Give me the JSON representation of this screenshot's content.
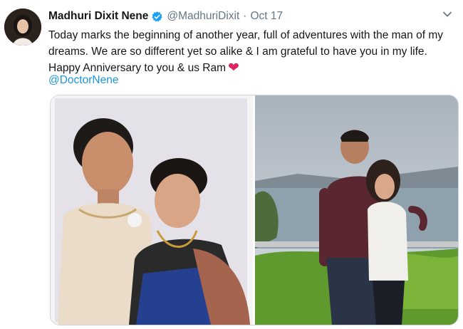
{
  "tweet": {
    "author_name": "Madhuri Dixit Nene",
    "handle": "@MadhuriDixit",
    "separator": "·",
    "date": "Oct 17",
    "text": "Today marks the beginning of another year, full of adventures with the man of my dreams. We are so different yet so alike & I am grateful to have you in my life. Happy Anniversary to you & us Ram",
    "mention": "@DoctorNene",
    "heart_glyph": "❤"
  },
  "icons": {
    "verified": "verified-badge-icon",
    "more": "chevron-down-icon",
    "heart": "heart-icon"
  },
  "colors": {
    "link": "#1b95e0",
    "verified": "#1da1f2",
    "muted": "#657786",
    "heart": "#e0245e"
  }
}
